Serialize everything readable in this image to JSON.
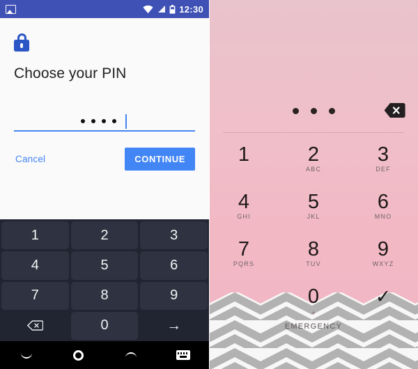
{
  "left_screen": {
    "status_bar": {
      "photo_icon": "photo-icon",
      "wifi_icon": "wifi-icon",
      "signal_icon": "signal-icon",
      "battery_icon": "battery-icon",
      "clock": "12:30"
    },
    "lock_icon": "lock-icon",
    "title": "Choose your PIN",
    "pin_input": {
      "masked_value": "••••",
      "dot_count": 4,
      "caret_visible": true
    },
    "cancel_label": "Cancel",
    "continue_label": "CONTINUE",
    "keyboard": {
      "rows": [
        [
          "1",
          "2",
          "3"
        ],
        [
          "4",
          "5",
          "6"
        ],
        [
          "7",
          "8",
          "9"
        ]
      ],
      "backspace_icon": "backspace-icon",
      "zero_label": "0",
      "enter_icon": "arrow-right-icon"
    },
    "nav_bar": {
      "back_icon": "chevron-down-icon",
      "home_icon": "circle-home-icon",
      "recents_icon": "chevron-up-icon",
      "keyboard_icon": "keyboard-icon"
    }
  },
  "right_screen": {
    "pin_dots_count": 3,
    "backspace_icon": "backspace-icon",
    "keypad": [
      {
        "number": "1",
        "letters": ""
      },
      {
        "number": "2",
        "letters": "ABC"
      },
      {
        "number": "3",
        "letters": "DEF"
      },
      {
        "number": "4",
        "letters": "GHI"
      },
      {
        "number": "5",
        "letters": "JKL"
      },
      {
        "number": "6",
        "letters": "MNO"
      },
      {
        "number": "7",
        "letters": "PQRS"
      },
      {
        "number": "8",
        "letters": "TUV"
      },
      {
        "number": "9",
        "letters": "WXYZ"
      }
    ],
    "zero_key": {
      "number": "0",
      "sub": "+"
    },
    "confirm_icon": "checkmark-icon",
    "emergency_label": "EMERGENCY"
  },
  "colors": {
    "status_bar": "#3f51b5",
    "accent_blue": "#4285f4",
    "lock_blue": "#2a56c6",
    "keyboard_bg": "#212431",
    "key_bg": "#2f3341",
    "nav_bg": "#000000",
    "pink_bg": "#f0bfc9",
    "chevron_gray": "#b0b0b0",
    "chevron_white": "#f7f7f7"
  }
}
